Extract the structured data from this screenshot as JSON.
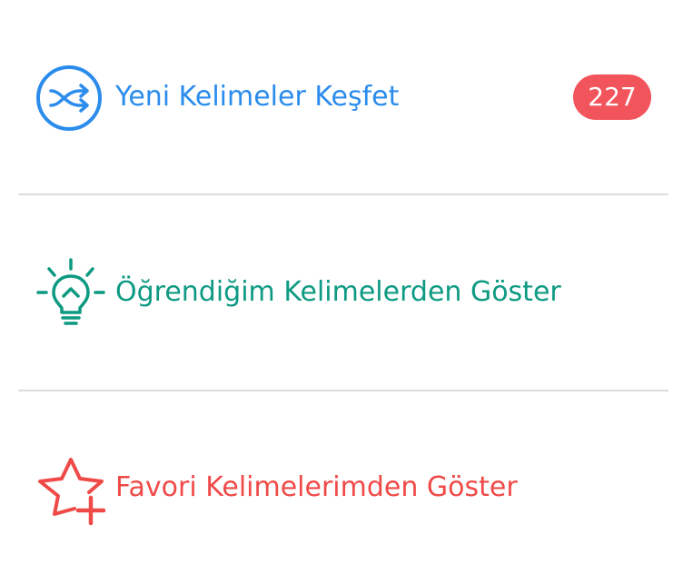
{
  "menu": {
    "items": [
      {
        "label": "Yeni Kelimeler Keşfet",
        "icon": "shuffle-icon",
        "color": "#2b8cec",
        "badge": "227",
        "badge_color": "#f2545b"
      },
      {
        "label": "Öğrendiğim Kelimelerden Göster",
        "icon": "lightbulb-icon",
        "color": "#0e9a82"
      },
      {
        "label": "Favori Kelimelerimden Göster",
        "icon": "star-plus-icon",
        "color": "#ef4a48"
      }
    ]
  }
}
